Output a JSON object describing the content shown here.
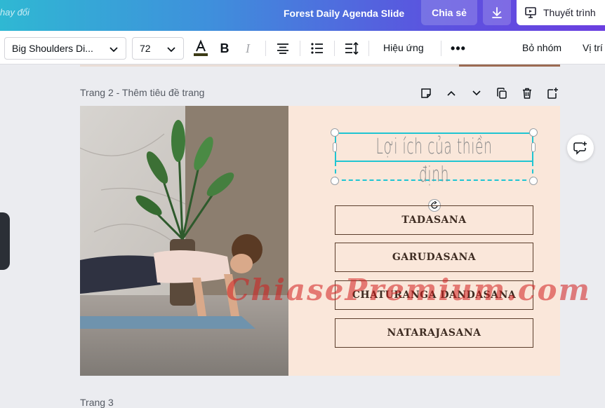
{
  "topbar": {
    "changed_label": "hay đổi",
    "doc_title": "Forest Daily Agenda Slide",
    "share_label": "Chia sẻ",
    "present_label": "Thuyết trình"
  },
  "toolbar": {
    "font_name": "Big Shoulders Di...",
    "font_size": "72",
    "effects_label": "Hiệu ứng",
    "ungroup_label": "Bỏ nhóm",
    "position_label": "Vị trí"
  },
  "page2": {
    "label": "Trang 2 - Thêm tiêu đề trang",
    "headline": "Lợi ích của thiền định",
    "poses": [
      "TADASANA",
      "GARUDASANA",
      "CHATURANGA DANDASANA",
      "NATARAJASANA"
    ]
  },
  "page3": {
    "label": "Trang 3"
  },
  "watermark": "ChiasePremium.com",
  "colors": {
    "selection": "#1fc5d2",
    "slide_bg": "#fae7da",
    "pose_border": "#5a3d2b",
    "watermark": "#d21e1e"
  }
}
